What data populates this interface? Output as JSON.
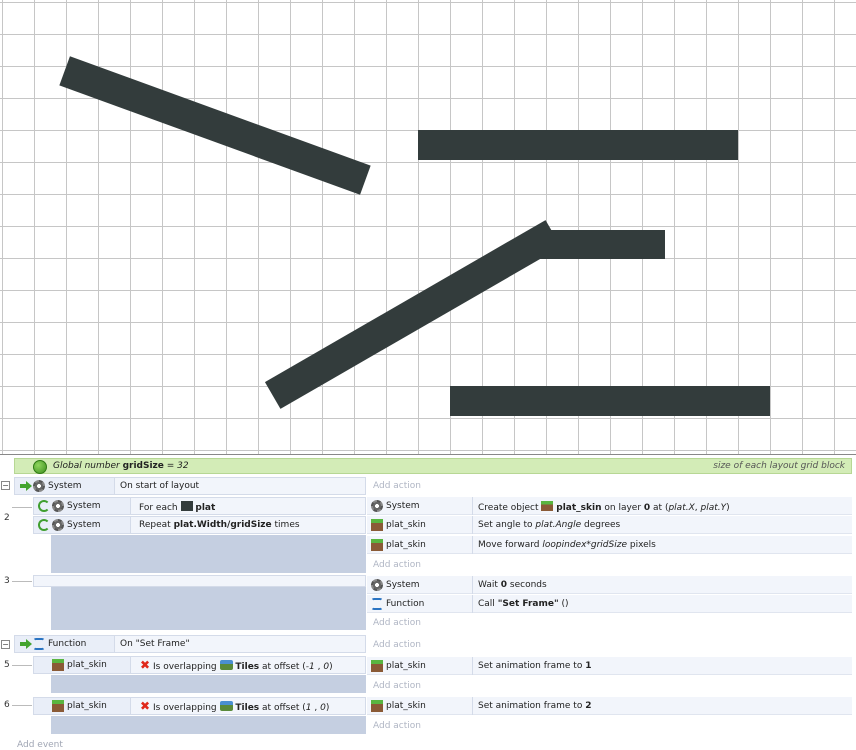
{
  "global_var": {
    "prefix": "Global number",
    "name": "gridSize",
    "assign": "= 32",
    "comment": "size of each layout grid block"
  },
  "events": {
    "e1": {
      "obj": "System",
      "cond": "On start of layout",
      "add_action": "Add action"
    },
    "e2": {
      "num": "2",
      "c1_obj": "System",
      "c1_pre": "For each",
      "c1_bold": "plat",
      "c2_obj": "System",
      "c2_pre": "Repeat",
      "c2_bold": "plat.Width/gridSize",
      "c2_post": "times",
      "a1_obj": "System",
      "a1_pre": "Create object",
      "a1_bold": "plat_skin",
      "a1_mid": "on layer",
      "a1_layer": "0",
      "a1_at": "at (",
      "a1_x": "plat.X",
      "a1_comma": ",",
      "a1_y": "plat.Y",
      "a1_close": ")",
      "a2_obj": "plat_skin",
      "a2_pre": "Set angle to",
      "a2_it": "plat.Angle",
      "a2_post": "degrees",
      "a3_obj": "plat_skin",
      "a3_pre": "Move forward",
      "a3_it": "loopindex*gridSize",
      "a3_post": "pixels",
      "add_action": "Add action"
    },
    "e3": {
      "num": "3",
      "a1_obj": "System",
      "a1_pre": "Wait",
      "a1_bold": "0",
      "a1_post": "seconds",
      "a2_obj": "Function",
      "a2_pre": "Call",
      "a2_bold": "\"Set Frame\"",
      "a2_post": "()",
      "add_action": "Add action"
    },
    "e4": {
      "obj": "Function",
      "cond": "On \"Set Frame\"",
      "add_action": "Add action"
    },
    "e5": {
      "num": "5",
      "c_obj": "plat_skin",
      "c_pre": "Is overlapping",
      "c_bold": "Tiles",
      "c_post": "at offset (",
      "c_x": "-1",
      "c_comma": ",",
      "c_y": "0",
      "c_close": ")",
      "a_obj": "plat_skin",
      "a_pre": "Set animation frame to",
      "a_bold": "1",
      "add_action": "Add action"
    },
    "e6": {
      "num": "6",
      "c_obj": "plat_skin",
      "c_pre": "Is overlapping",
      "c_bold": "Tiles",
      "c_post": "at offset (",
      "c_x": "1",
      "c_comma": ",",
      "c_y": "0",
      "c_close": ")",
      "a_obj": "plat_skin",
      "a_pre": "Set animation frame to",
      "a_bold": "2",
      "add_action": "Add action"
    }
  },
  "add_event": "Add event",
  "colors": {
    "platform": "#333c3c",
    "grid_line": "#c6c6c6",
    "global_bar": "#d3ecb7",
    "row_bg": "#f2f5fb",
    "blank_fill": "#c5cfe1"
  },
  "icons": [
    "gear-icon",
    "globe-icon",
    "trigger-arrow-icon",
    "loop-icon",
    "function-icon",
    "x-invert-icon",
    "tiles-icon",
    "grass-sprite-icon"
  ]
}
